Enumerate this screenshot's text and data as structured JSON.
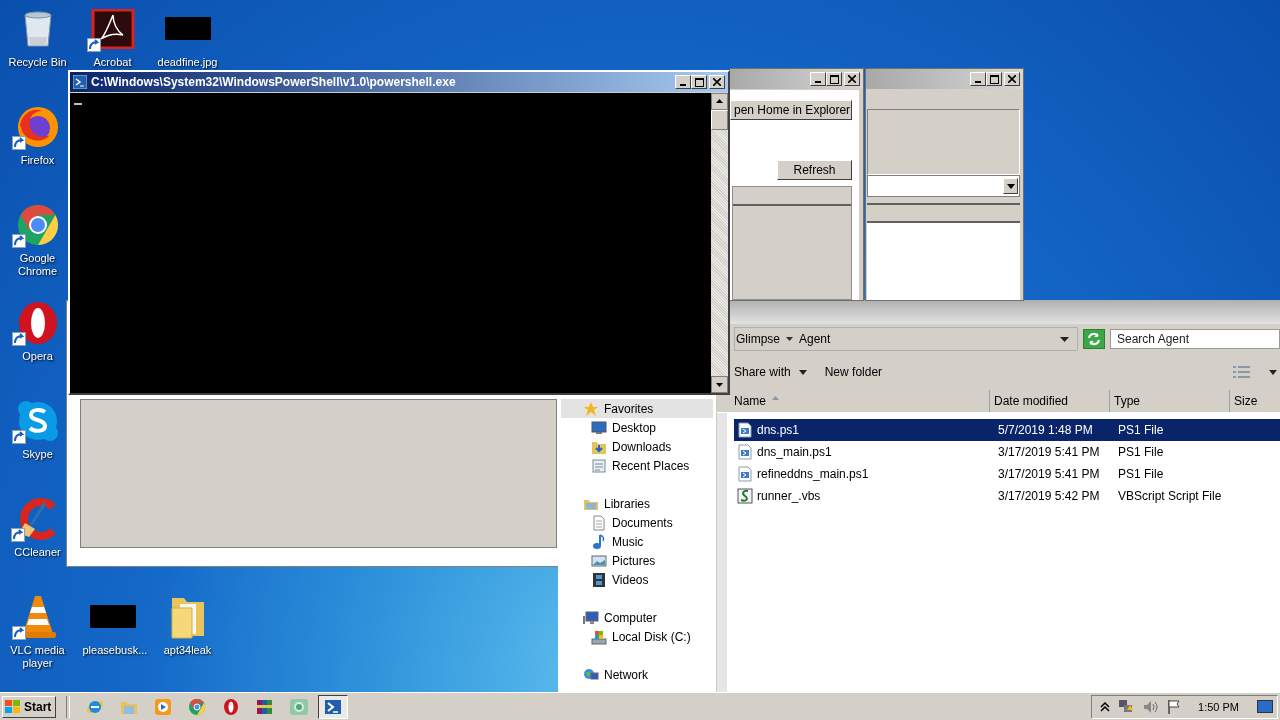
{
  "desktop_icons": [
    {
      "label": "Recycle Bin",
      "kind": "recycle-bin",
      "shortcut": false
    },
    {
      "label": "Acrobat",
      "kind": "acrobat",
      "shortcut": true
    },
    {
      "label": "deadfine.jpg",
      "kind": "black-thumbnail",
      "shortcut": false
    },
    {
      "label": "Firefox",
      "kind": "firefox",
      "shortcut": true
    },
    {
      "label": "Google Chrome",
      "kind": "chrome",
      "shortcut": true
    },
    {
      "label": "Opera",
      "kind": "opera",
      "shortcut": true
    },
    {
      "label": "Skype",
      "kind": "skype",
      "shortcut": true
    },
    {
      "label": "CCleaner",
      "kind": "ccleaner",
      "shortcut": true
    },
    {
      "label": "VLC media player",
      "kind": "vlc",
      "shortcut": true
    },
    {
      "label": "pleasebusk...",
      "kind": "black-thumbnail",
      "shortcut": false
    },
    {
      "label": "apt34leak",
      "kind": "folder",
      "shortcut": false
    }
  ],
  "console_window": {
    "title": "C:\\Windows\\System32\\WindowsPowerShell\\v1.0\\powershell.exe"
  },
  "home_window": {
    "buttons": [
      "pen Home in Explorer",
      "Refresh"
    ]
  },
  "explorer": {
    "breadcrumb": [
      "Glimpse",
      "Agent"
    ],
    "search": {
      "placeholder": "Search Agent"
    },
    "toolbar": [
      {
        "label": "Share with",
        "dropdown": true
      },
      {
        "label": "New folder",
        "dropdown": false
      }
    ],
    "nav": [
      {
        "label": "Favorites",
        "kind": "star",
        "selected": true,
        "children": [
          {
            "label": "Desktop",
            "kind": "desktop",
            "selected": false
          },
          {
            "label": "Downloads",
            "kind": "downloads",
            "selected": false
          },
          {
            "label": "Recent Places",
            "kind": "recent",
            "selected": false
          }
        ]
      },
      {
        "label": "Libraries",
        "kind": "library",
        "selected": false,
        "children": [
          {
            "label": "Documents",
            "kind": "documents",
            "selected": false
          },
          {
            "label": "Music",
            "kind": "music",
            "selected": false
          },
          {
            "label": "Pictures",
            "kind": "pictures",
            "selected": false
          },
          {
            "label": "Videos",
            "kind": "videos",
            "selected": false
          }
        ]
      },
      {
        "label": "Computer",
        "kind": "computer",
        "selected": false,
        "children": [
          {
            "label": "Local Disk (C:)",
            "kind": "disk",
            "selected": false
          }
        ]
      },
      {
        "label": "Network",
        "kind": "network",
        "selected": false
      }
    ],
    "columns": [
      {
        "label": "Name",
        "sorted": true
      },
      {
        "label": "Date modified",
        "sorted": false
      },
      {
        "label": "Type",
        "sorted": false
      },
      {
        "label": "Size",
        "sorted": false
      }
    ],
    "rows": [
      {
        "name": "dns.ps1",
        "date": "5/7/2019 1:48 PM",
        "type": "PS1 File",
        "kind": "ps1",
        "selected": true
      },
      {
        "name": "dns_main.ps1",
        "date": "3/17/2019 5:41 PM",
        "type": "PS1 File",
        "kind": "ps1",
        "selected": false
      },
      {
        "name": "refineddns_main.ps1",
        "date": "3/17/2019 5:41 PM",
        "type": "PS1 File",
        "kind": "ps1",
        "selected": false
      },
      {
        "name": "runner_.vbs",
        "date": "3/17/2019 5:42 PM",
        "type": "VBScript Script File",
        "kind": "vbs",
        "selected": false
      }
    ]
  },
  "taskbar": {
    "start": "Start",
    "items": [
      {
        "kind": "ie",
        "selected": false
      },
      {
        "kind": "explorer",
        "selected": false
      },
      {
        "kind": "media-player",
        "selected": false
      },
      {
        "kind": "chrome",
        "selected": false
      },
      {
        "kind": "opera",
        "selected": false
      },
      {
        "kind": "winrar",
        "selected": false
      },
      {
        "kind": "green-app",
        "selected": false
      },
      {
        "kind": "powershell",
        "selected": true
      }
    ],
    "clock": "1:50 PM"
  }
}
